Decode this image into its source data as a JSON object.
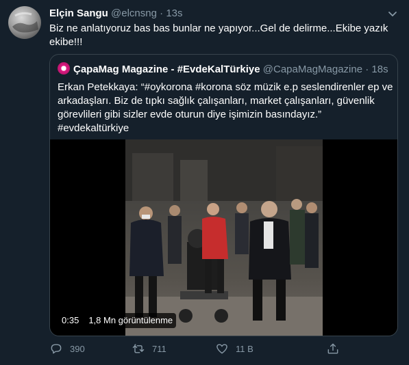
{
  "tweet": {
    "author_name": "Elçin Sangu",
    "author_handle": "@elcnsng",
    "separator": "·",
    "time": "13s",
    "text": "Biz ne anlatıyoruz bas bas bunlar ne yapıyor...Gel de delirme...Ekibe yazık ekibe!!!"
  },
  "quoted_tweet": {
    "author_name": "ÇapaMag Magazine - #EvdeKalTürkiye",
    "author_handle": "@CapaMagMagazine",
    "separator": "·",
    "time": "18s",
    "text": "Erkan Petekkaya: “#oykorona #korona söz müzik e.p seslendirenler ep ve arkadaşları. Biz de tıpkı sağlık çalışanları, market çalışanları, güvenlik görevlileri gibi sizler evde oturun diye işimizin basındayız.” #evdekaltürkiye",
    "video": {
      "duration": "0:35",
      "views": "1,8 Mn görüntülenme"
    }
  },
  "actions": {
    "reply_count": "390",
    "retweet_count": "711",
    "like_count": "11 B"
  },
  "icons": {
    "reply": "reply-icon",
    "retweet": "retweet-icon",
    "like": "heart-icon",
    "share": "share-icon",
    "more": "chevron-down-icon"
  },
  "colors": {
    "background": "#15202b",
    "secondary_text": "#8899a6",
    "border": "#38444d",
    "quote_avatar": "#e01b84"
  }
}
